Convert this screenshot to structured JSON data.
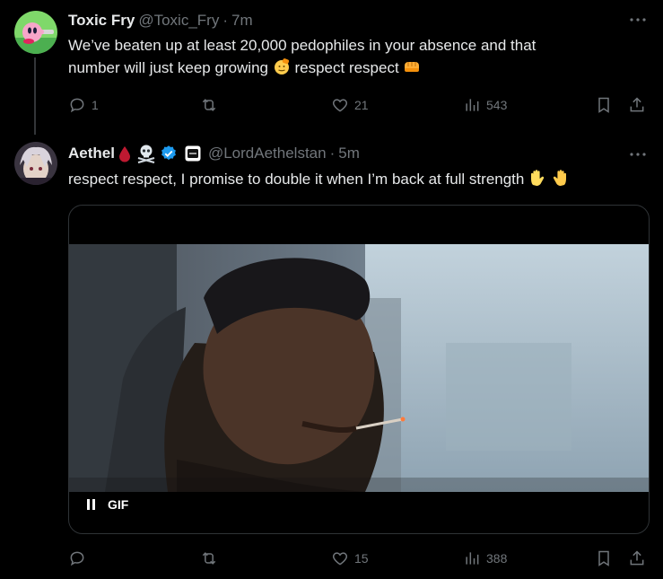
{
  "tweet1": {
    "name": "Toxic Fry",
    "handle": "@Toxic_Fry",
    "separator": "·",
    "time": "7m",
    "text_line1": "We’ve beaten up at least 20,000 pedophiles in your absence and that",
    "text_line2a": "number will just keep growing",
    "text_line2b": "respect respect",
    "reply_count": "1",
    "retweet_count": "",
    "like_count": "21",
    "views_count": "543"
  },
  "tweet2": {
    "name": "Aethel",
    "handle": "@LordAethelstan",
    "separator": "·",
    "time": "5m",
    "text_a": "respect respect, I promise to double it when I’m back at full strength",
    "reply_count": "",
    "retweet_count": "",
    "like_count": "15",
    "views_count": "388",
    "media_badge": "GIF"
  },
  "icons": {
    "more": "more-icon",
    "reply": "reply-icon",
    "retweet": "retweet-icon",
    "like": "heart-icon",
    "views": "views-icon",
    "bookmark": "bookmark-icon",
    "share": "share-icon"
  },
  "colors": {
    "background": "#000000",
    "text": "#e7e9ea",
    "muted": "#71767b",
    "verified": "#1d9bf0",
    "border": "#2f3336"
  }
}
